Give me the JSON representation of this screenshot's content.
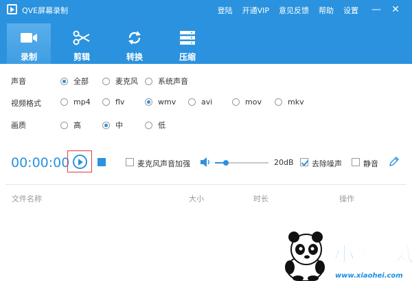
{
  "app": {
    "title": "QVE屏幕录制"
  },
  "top_menu": [
    "登陆",
    "开通VIP",
    "意见反馈",
    "帮助",
    "设置"
  ],
  "tabs": [
    {
      "label": "录制",
      "icon": "video-camera-icon",
      "active": true
    },
    {
      "label": "剪辑",
      "icon": "scissors-icon",
      "active": false
    },
    {
      "label": "转换",
      "icon": "convert-icon",
      "active": false
    },
    {
      "label": "压缩",
      "icon": "compress-icon",
      "active": false
    }
  ],
  "options": {
    "audio": {
      "label": "声音",
      "choices": [
        "全部",
        "麦克风",
        "系统声音"
      ],
      "selected": "全部"
    },
    "format": {
      "label": "视频格式",
      "choices": [
        "mp4",
        "flv",
        "wmv",
        "avi",
        "mov",
        "mkv"
      ],
      "selected": "wmv"
    },
    "quality": {
      "label": "画质",
      "choices": [
        "高",
        "中",
        "低"
      ],
      "selected": "中"
    }
  },
  "controls": {
    "timer": "00:00:00",
    "mic_boost_label": "麦克风声音加强",
    "mic_boost_checked": false,
    "volume_db": "20dB",
    "volume_level": 0.2,
    "denoise_label": "去除噪声",
    "denoise_checked": true,
    "mute_label": "静音",
    "mute_checked": false
  },
  "file_list": {
    "columns": [
      "文件名称",
      "大小",
      "时长",
      "操作"
    ]
  },
  "watermark": {
    "brand": "小黑游戏",
    "url": "www.xiaohei.com"
  },
  "colors": {
    "accent": "#2a92de",
    "highlight_border": "#e23b3b"
  }
}
